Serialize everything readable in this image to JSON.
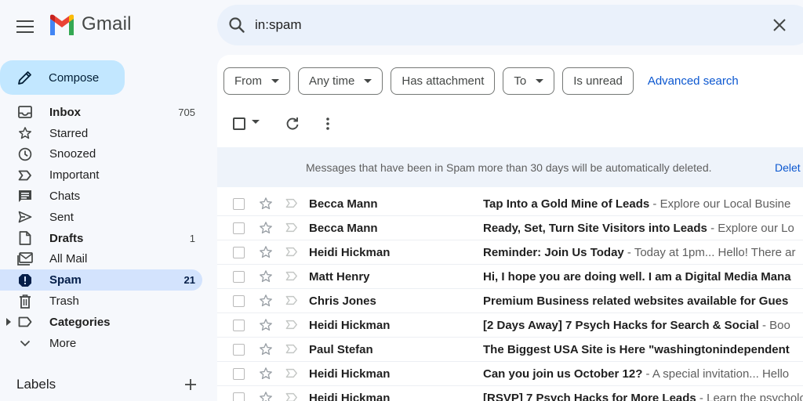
{
  "app": {
    "name": "Gmail",
    "brand_colors": [
      "#ea4335",
      "#4285f4",
      "#34a853",
      "#fbbc04",
      "#c5221f"
    ]
  },
  "search": {
    "value": "in:spam"
  },
  "compose": {
    "label": "Compose"
  },
  "nav": [
    {
      "label": "Inbox",
      "count": "705",
      "icon": "inbox-icon",
      "bold": true
    },
    {
      "label": "Starred",
      "count": "",
      "icon": "star-icon"
    },
    {
      "label": "Snoozed",
      "count": "",
      "icon": "clock-icon"
    },
    {
      "label": "Important",
      "count": "",
      "icon": "important-icon"
    },
    {
      "label": "Chats",
      "count": "",
      "icon": "chat-icon"
    },
    {
      "label": "Sent",
      "count": "",
      "icon": "send-icon"
    },
    {
      "label": "Drafts",
      "count": "1",
      "icon": "draft-icon",
      "bold": true
    },
    {
      "label": "All Mail",
      "count": "",
      "icon": "all-mail-icon"
    },
    {
      "label": "Spam",
      "count": "21",
      "icon": "spam-icon",
      "active": true
    },
    {
      "label": "Trash",
      "count": "",
      "icon": "trash-icon"
    },
    {
      "label": "Categories",
      "count": "",
      "icon": "label-icon",
      "bold": true
    },
    {
      "label": "More",
      "count": "",
      "icon": "chevron-down-icon"
    }
  ],
  "labels": {
    "title": "Labels"
  },
  "filters": {
    "chips": [
      {
        "label": "From",
        "dropdown": true
      },
      {
        "label": "Any time",
        "dropdown": true
      },
      {
        "label": "Has attachment",
        "dropdown": false
      },
      {
        "label": "To",
        "dropdown": true
      },
      {
        "label": "Is unread",
        "dropdown": false
      }
    ],
    "advanced": "Advanced search"
  },
  "notice": {
    "text": "Messages that have been in Spam more than 30 days will be automatically deleted.",
    "link": "Delet"
  },
  "emails": [
    {
      "sender": "Becca Mann",
      "subject": "Tap Into a Gold Mine of Leads",
      "snippet": " - Explore our Local Busine"
    },
    {
      "sender": "Becca Mann",
      "subject": "Ready, Set, Turn Site Visitors into Leads",
      "snippet": " - Explore our Lo"
    },
    {
      "sender": "Heidi Hickman",
      "subject": "Reminder: Join Us Today",
      "snippet": " - Today at 1pm... Hello! There ar"
    },
    {
      "sender": "Matt Henry",
      "subject": "Hi, I hope you are doing well. I am a Digital Media Mana",
      "snippet": ""
    },
    {
      "sender": "Chris Jones",
      "subject": "Premium Business related websites available for Gues",
      "snippet": ""
    },
    {
      "sender": "Heidi Hickman",
      "subject": "[2 Days Away] 7 Psych Hacks for Search & Social",
      "snippet": " - Boo"
    },
    {
      "sender": "Paul Stefan",
      "subject": "The Biggest USA Site is Here \"washingtonindependent",
      "snippet": ""
    },
    {
      "sender": "Heidi Hickman",
      "subject": "Can you join us October 12?",
      "snippet": " - A special invitation... Hello"
    },
    {
      "sender": "Heidi Hickman",
      "subject": "[RSVP] 7 Psych Hacks for More Leads",
      "snippet": " - Learn the psychology"
    }
  ]
}
